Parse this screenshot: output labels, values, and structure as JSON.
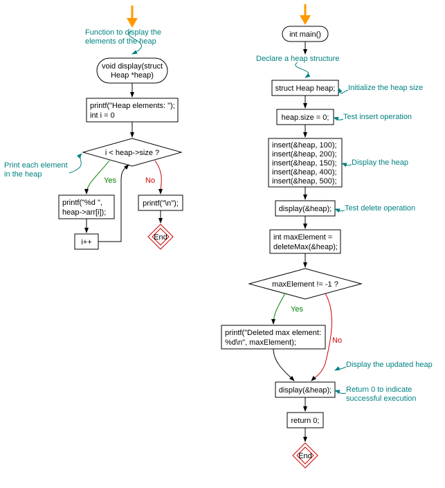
{
  "chart_data": [
    {
      "type": "flowchart",
      "title": "Function to display the elements of the heap",
      "nodes": [
        {
          "id": "start1",
          "shape": "start-arrow"
        },
        {
          "id": "disp_func",
          "shape": "terminal",
          "text": "void display(struct\nHeap *heap)"
        },
        {
          "id": "init_loop",
          "shape": "process",
          "text": "printf(\"Heap elements: \");\nint i = 0"
        },
        {
          "id": "cond_loop",
          "shape": "decision",
          "text": "i < heap->size ?"
        },
        {
          "id": "print_el",
          "shape": "process",
          "text": "printf(\"%d \",\nheap->arr[i]);"
        },
        {
          "id": "incr",
          "shape": "process",
          "text": "i++"
        },
        {
          "id": "newline",
          "shape": "process",
          "text": "printf(\"\\n\");"
        },
        {
          "id": "end1",
          "shape": "end",
          "text": "End"
        }
      ],
      "edges": [
        {
          "from": "start1",
          "to": "disp_func"
        },
        {
          "from": "disp_func",
          "to": "init_loop"
        },
        {
          "from": "init_loop",
          "to": "cond_loop"
        },
        {
          "from": "cond_loop",
          "to": "print_el",
          "label": "Yes"
        },
        {
          "from": "print_el",
          "to": "incr"
        },
        {
          "from": "incr",
          "to": "cond_loop"
        },
        {
          "from": "cond_loop",
          "to": "newline",
          "label": "No"
        },
        {
          "from": "newline",
          "to": "end1"
        }
      ],
      "annotations": [
        {
          "text": "Function to display the\nelements of the heap",
          "target": "start1"
        },
        {
          "text": "Print each element\nin the heap",
          "target": "cond_loop"
        }
      ]
    },
    {
      "type": "flowchart",
      "title": "int main()",
      "nodes": [
        {
          "id": "start2",
          "shape": "start-arrow"
        },
        {
          "id": "main_func",
          "shape": "terminal",
          "text": "int main()"
        },
        {
          "id": "decl_heap",
          "shape": "process",
          "text": "struct Heap heap;"
        },
        {
          "id": "init_size",
          "shape": "process",
          "text": "heap.size = 0;"
        },
        {
          "id": "inserts",
          "shape": "process",
          "text": "insert(&heap, 100);\ninsert(&heap, 200);\ninsert(&heap, 150);\ninsert(&heap, 400);\ninsert(&heap, 500);"
        },
        {
          "id": "display1",
          "shape": "process",
          "text": "display(&heap);"
        },
        {
          "id": "delmax",
          "shape": "process",
          "text": "int maxElement =\ndeleteMax(&heap);"
        },
        {
          "id": "cond_max",
          "shape": "decision",
          "text": "maxElement != -1 ?"
        },
        {
          "id": "print_del",
          "shape": "process",
          "text": "printf(\"Deleted max element:\n%d\\n\", maxElement);"
        },
        {
          "id": "display2",
          "shape": "process",
          "text": "display(&heap);"
        },
        {
          "id": "return0",
          "shape": "process",
          "text": "return 0;"
        },
        {
          "id": "end2",
          "shape": "end",
          "text": "End"
        }
      ],
      "edges": [
        {
          "from": "start2",
          "to": "main_func"
        },
        {
          "from": "main_func",
          "to": "decl_heap"
        },
        {
          "from": "decl_heap",
          "to": "init_size"
        },
        {
          "from": "init_size",
          "to": "inserts"
        },
        {
          "from": "inserts",
          "to": "display1"
        },
        {
          "from": "display1",
          "to": "delmax"
        },
        {
          "from": "delmax",
          "to": "cond_max"
        },
        {
          "from": "cond_max",
          "to": "print_del",
          "label": "Yes"
        },
        {
          "from": "print_del",
          "to": "display2"
        },
        {
          "from": "cond_max",
          "to": "display2",
          "label": "No"
        },
        {
          "from": "display2",
          "to": "return0"
        },
        {
          "from": "return0",
          "to": "end2"
        }
      ],
      "annotations": [
        {
          "text": "Declare a heap structure",
          "target": "main_func"
        },
        {
          "text": "Initialize the heap size",
          "target": "decl_heap"
        },
        {
          "text": "Test insert operation",
          "target": "init_size"
        },
        {
          "text": "Display the heap",
          "target": "inserts"
        },
        {
          "text": "Test delete operation",
          "target": "display1"
        },
        {
          "text": "Display the updated heap",
          "target": "display2"
        },
        {
          "text": "Return 0 to indicate\nsuccessful execution",
          "target": "return0"
        }
      ]
    }
  ],
  "labels": {
    "yes": "Yes",
    "no": "No",
    "end": "End"
  },
  "left": {
    "ann_func": "Function to display the\nelements of the heap",
    "func_sig": "void display(struct\nHeap *heap)",
    "init_loop_l1": "printf(\"Heap elements: \");",
    "init_loop_l2": "int i = 0",
    "cond_loop": "i < heap->size ?",
    "ann_print": "Print each element\nin the heap",
    "print_el_l1": "printf(\"%d \",",
    "print_el_l2": "heap->arr[i]);",
    "incr": "i++",
    "newline": "printf(\"\\n\");"
  },
  "right": {
    "main_sig": "int main()",
    "ann_decl": "Declare a heap structure",
    "decl_heap": "struct Heap heap;",
    "ann_init": "Initialize the heap size",
    "init_size": "heap.size = 0;",
    "ann_insert": "Test insert operation",
    "ins1": "insert(&heap, 100);",
    "ins2": "insert(&heap, 200);",
    "ins3": "insert(&heap, 150);",
    "ins4": "insert(&heap, 400);",
    "ins5": "insert(&heap, 500);",
    "ann_disp": "Display the heap",
    "display1": "display(&heap);",
    "ann_del": "Test delete operation",
    "delmax_l1": "int maxElement =",
    "delmax_l2": "deleteMax(&heap);",
    "cond_max": "maxElement != -1 ?",
    "print_del_l1": "printf(\"Deleted max element:",
    "print_del_l2": "%d\\n\", maxElement);",
    "ann_disp2": "Display the updated heap",
    "display2": "display(&heap);",
    "ann_ret": "Return 0 to indicate\nsuccessful execution",
    "return0": "return 0;"
  }
}
